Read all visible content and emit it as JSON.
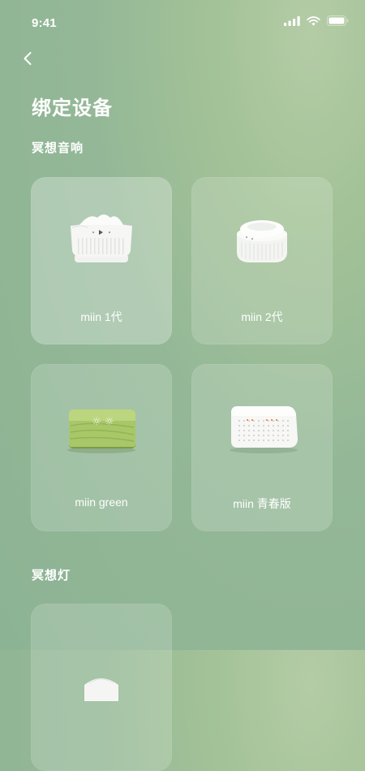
{
  "status_bar": {
    "time": "9:41"
  },
  "header": {
    "title": "绑定设备"
  },
  "sections": [
    {
      "title": "冥想音响",
      "devices": [
        {
          "name": "miin 1代",
          "icon": "speaker-gen1-image"
        },
        {
          "name": "miin 2代",
          "icon": "speaker-gen2-image"
        },
        {
          "name": "miin green",
          "icon": "speaker-green-image"
        },
        {
          "name": "miin 青春版",
          "icon": "speaker-youth-image"
        }
      ]
    },
    {
      "title": "冥想灯",
      "devices": [
        {
          "name": "",
          "icon": "meditation-lamp-image"
        }
      ]
    }
  ],
  "colors": {
    "background": "#94b897",
    "card": "rgba(255,255,255,0.17)",
    "text": "#ffffff"
  }
}
